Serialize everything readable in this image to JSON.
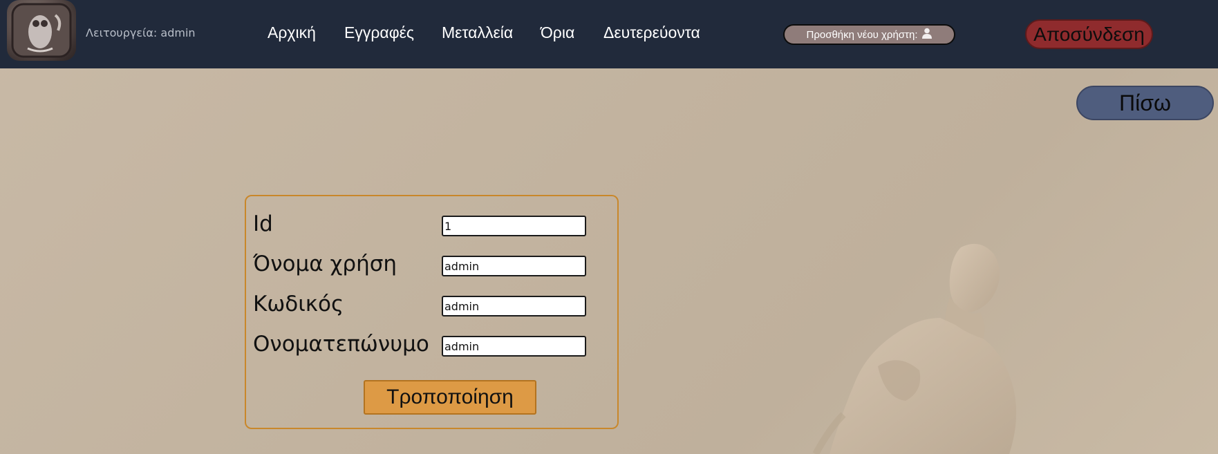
{
  "header": {
    "logo_icon": "owl-coin-logo",
    "mode_text": "Λειτουργεία: admin",
    "nav": [
      "Αρχική",
      "Εγγραφές",
      "Μεταλλεία",
      "Όρια",
      "Δευτερεύοντα"
    ],
    "add_user_label": "Προσθήκη νέου χρήστη:",
    "add_user_icon": "user-icon",
    "logout_label": "Αποσύνδεση"
  },
  "back_label": "Πίσω",
  "form": {
    "fields": [
      {
        "label": "Id",
        "value": "1"
      },
      {
        "label": "Όνομα χρήση",
        "value": "admin"
      },
      {
        "label": "Κωδικός",
        "value": "admin"
      },
      {
        "label": "Ονοματεπώνυμο",
        "value": "admin"
      }
    ],
    "submit_label": "Τροποποίηση"
  },
  "colors": {
    "navbar": "#212a3b",
    "logout": "#8f2b2d",
    "back": "#4f5d7e",
    "submit": "#dd9a45",
    "form_border": "#c9872a"
  }
}
